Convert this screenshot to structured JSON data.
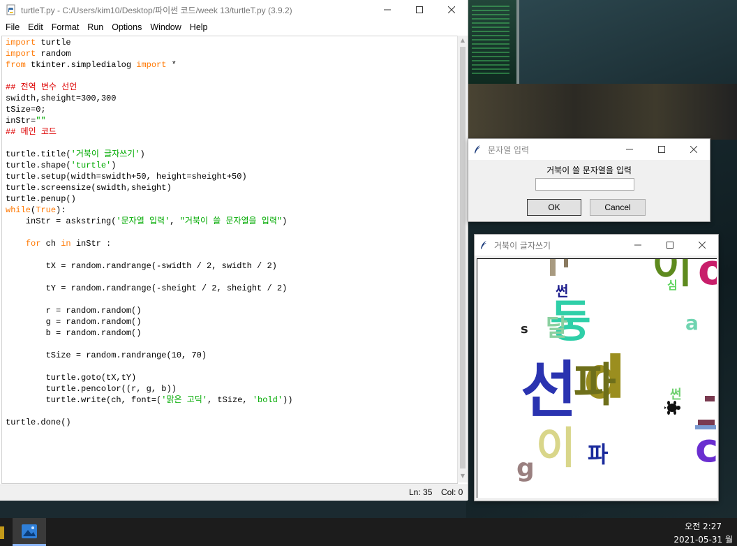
{
  "idle": {
    "title": "turtleT.py - C:/Users/kim10/Desktop/파이썬 코드/week 13/turtleT.py (3.9.2)",
    "menu": [
      "File",
      "Edit",
      "Format",
      "Run",
      "Options",
      "Window",
      "Help"
    ],
    "code_lines": [
      "import turtle",
      "import random",
      "from tkinter.simpledialog import *",
      "",
      "## 전역 변수 선언",
      "swidth,sheight=300,300",
      "tSize=0;",
      "inStr=\"\"",
      "## 메인 코드",
      "",
      "turtle.title('거북이 글자쓰기')",
      "turtle.shape('turtle')",
      "turtle.setup(width=swidth+50, height=sheight+50)",
      "turtle.screensize(swidth,sheight)",
      "turtle.penup()",
      "while(True):",
      "    inStr = askstring('문자열 입력', \"거북이 쓸 문자열을 입력\")",
      "",
      "    for ch in inStr :",
      "",
      "        tX = random.randrange(-swidth / 2, swidth / 2)",
      "",
      "        tY = random.randrange(-sheight / 2, sheight / 2)",
      "",
      "        r = random.random()",
      "        g = random.random()",
      "        b = random.random()",
      "",
      "        tSize = random.randrange(10, 70)",
      "",
      "        turtle.goto(tX,tY)",
      "        turtle.pencolor((r, g, b))",
      "        turtle.write(ch, font=('맑은 고딕', tSize, 'bold'))",
      "",
      "turtle.done()"
    ],
    "status": {
      "ln": "Ln: 35",
      "col": "Col: 0"
    }
  },
  "dialog": {
    "title": "문자열 입력",
    "prompt": "거북이 쓸 문자열을 입력",
    "input_value": "",
    "ok_label": "OK",
    "cancel_label": "Cancel"
  },
  "turtle_window": {
    "title": "거북이 글자쓰기",
    "chars": [
      {
        "ch": "썬",
        "color": "#1c1c8c"
      },
      {
        "ch": "둥",
        "color": "#2fcfa8"
      },
      {
        "ch": "s",
        "color": "#222222"
      },
      {
        "ch": "심",
        "color": "#5fd45f"
      },
      {
        "ch": "a",
        "color": "#6fd4b0"
      },
      {
        "ch": "선",
        "color": "#2a33b0"
      },
      {
        "ch": "d",
        "color": "#9b8e1f"
      },
      {
        "ch": "파",
        "color": "#6e6f1a"
      },
      {
        "ch": "썬",
        "color": "#6ed06e"
      },
      {
        "ch": "이",
        "color": "#d9d68a"
      },
      {
        "ch": "파",
        "color": "#1a2a9c"
      },
      {
        "ch": "g",
        "color": "#9a8080"
      },
      {
        "ch": "c",
        "color": "#6a2ed0"
      },
      {
        "ch": "이",
        "color": "#5e8a1e"
      },
      {
        "ch": "o",
        "color": "#c81e6a"
      },
      {
        "ch": "달",
        "color": "#8bd0a0"
      }
    ]
  },
  "taskbar": {
    "time": "오전 2:27",
    "date": "2021-05-31 월"
  }
}
